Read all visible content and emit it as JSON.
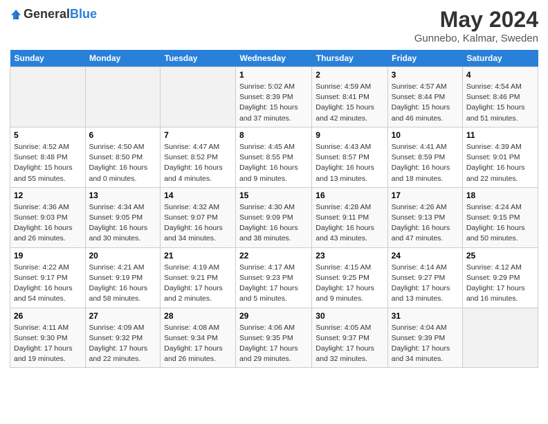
{
  "logo": {
    "general": "General",
    "blue": "Blue"
  },
  "title": "May 2024",
  "subtitle": "Gunnebo, Kalmar, Sweden",
  "headers": [
    "Sunday",
    "Monday",
    "Tuesday",
    "Wednesday",
    "Thursday",
    "Friday",
    "Saturday"
  ],
  "weeks": [
    [
      {
        "num": "",
        "detail": ""
      },
      {
        "num": "",
        "detail": ""
      },
      {
        "num": "",
        "detail": ""
      },
      {
        "num": "1",
        "detail": "Sunrise: 5:02 AM\nSunset: 8:39 PM\nDaylight: 15 hours\nand 37 minutes."
      },
      {
        "num": "2",
        "detail": "Sunrise: 4:59 AM\nSunset: 8:41 PM\nDaylight: 15 hours\nand 42 minutes."
      },
      {
        "num": "3",
        "detail": "Sunrise: 4:57 AM\nSunset: 8:44 PM\nDaylight: 15 hours\nand 46 minutes."
      },
      {
        "num": "4",
        "detail": "Sunrise: 4:54 AM\nSunset: 8:46 PM\nDaylight: 15 hours\nand 51 minutes."
      }
    ],
    [
      {
        "num": "5",
        "detail": "Sunrise: 4:52 AM\nSunset: 8:48 PM\nDaylight: 15 hours\nand 55 minutes."
      },
      {
        "num": "6",
        "detail": "Sunrise: 4:50 AM\nSunset: 8:50 PM\nDaylight: 16 hours\nand 0 minutes."
      },
      {
        "num": "7",
        "detail": "Sunrise: 4:47 AM\nSunset: 8:52 PM\nDaylight: 16 hours\nand 4 minutes."
      },
      {
        "num": "8",
        "detail": "Sunrise: 4:45 AM\nSunset: 8:55 PM\nDaylight: 16 hours\nand 9 minutes."
      },
      {
        "num": "9",
        "detail": "Sunrise: 4:43 AM\nSunset: 8:57 PM\nDaylight: 16 hours\nand 13 minutes."
      },
      {
        "num": "10",
        "detail": "Sunrise: 4:41 AM\nSunset: 8:59 PM\nDaylight: 16 hours\nand 18 minutes."
      },
      {
        "num": "11",
        "detail": "Sunrise: 4:39 AM\nSunset: 9:01 PM\nDaylight: 16 hours\nand 22 minutes."
      }
    ],
    [
      {
        "num": "12",
        "detail": "Sunrise: 4:36 AM\nSunset: 9:03 PM\nDaylight: 16 hours\nand 26 minutes."
      },
      {
        "num": "13",
        "detail": "Sunrise: 4:34 AM\nSunset: 9:05 PM\nDaylight: 16 hours\nand 30 minutes."
      },
      {
        "num": "14",
        "detail": "Sunrise: 4:32 AM\nSunset: 9:07 PM\nDaylight: 16 hours\nand 34 minutes."
      },
      {
        "num": "15",
        "detail": "Sunrise: 4:30 AM\nSunset: 9:09 PM\nDaylight: 16 hours\nand 38 minutes."
      },
      {
        "num": "16",
        "detail": "Sunrise: 4:28 AM\nSunset: 9:11 PM\nDaylight: 16 hours\nand 43 minutes."
      },
      {
        "num": "17",
        "detail": "Sunrise: 4:26 AM\nSunset: 9:13 PM\nDaylight: 16 hours\nand 47 minutes."
      },
      {
        "num": "18",
        "detail": "Sunrise: 4:24 AM\nSunset: 9:15 PM\nDaylight: 16 hours\nand 50 minutes."
      }
    ],
    [
      {
        "num": "19",
        "detail": "Sunrise: 4:22 AM\nSunset: 9:17 PM\nDaylight: 16 hours\nand 54 minutes."
      },
      {
        "num": "20",
        "detail": "Sunrise: 4:21 AM\nSunset: 9:19 PM\nDaylight: 16 hours\nand 58 minutes."
      },
      {
        "num": "21",
        "detail": "Sunrise: 4:19 AM\nSunset: 9:21 PM\nDaylight: 17 hours\nand 2 minutes."
      },
      {
        "num": "22",
        "detail": "Sunrise: 4:17 AM\nSunset: 9:23 PM\nDaylight: 17 hours\nand 5 minutes."
      },
      {
        "num": "23",
        "detail": "Sunrise: 4:15 AM\nSunset: 9:25 PM\nDaylight: 17 hours\nand 9 minutes."
      },
      {
        "num": "24",
        "detail": "Sunrise: 4:14 AM\nSunset: 9:27 PM\nDaylight: 17 hours\nand 13 minutes."
      },
      {
        "num": "25",
        "detail": "Sunrise: 4:12 AM\nSunset: 9:29 PM\nDaylight: 17 hours\nand 16 minutes."
      }
    ],
    [
      {
        "num": "26",
        "detail": "Sunrise: 4:11 AM\nSunset: 9:30 PM\nDaylight: 17 hours\nand 19 minutes."
      },
      {
        "num": "27",
        "detail": "Sunrise: 4:09 AM\nSunset: 9:32 PM\nDaylight: 17 hours\nand 22 minutes."
      },
      {
        "num": "28",
        "detail": "Sunrise: 4:08 AM\nSunset: 9:34 PM\nDaylight: 17 hours\nand 26 minutes."
      },
      {
        "num": "29",
        "detail": "Sunrise: 4:06 AM\nSunset: 9:35 PM\nDaylight: 17 hours\nand 29 minutes."
      },
      {
        "num": "30",
        "detail": "Sunrise: 4:05 AM\nSunset: 9:37 PM\nDaylight: 17 hours\nand 32 minutes."
      },
      {
        "num": "31",
        "detail": "Sunrise: 4:04 AM\nSunset: 9:39 PM\nDaylight: 17 hours\nand 34 minutes."
      },
      {
        "num": "",
        "detail": ""
      }
    ]
  ]
}
